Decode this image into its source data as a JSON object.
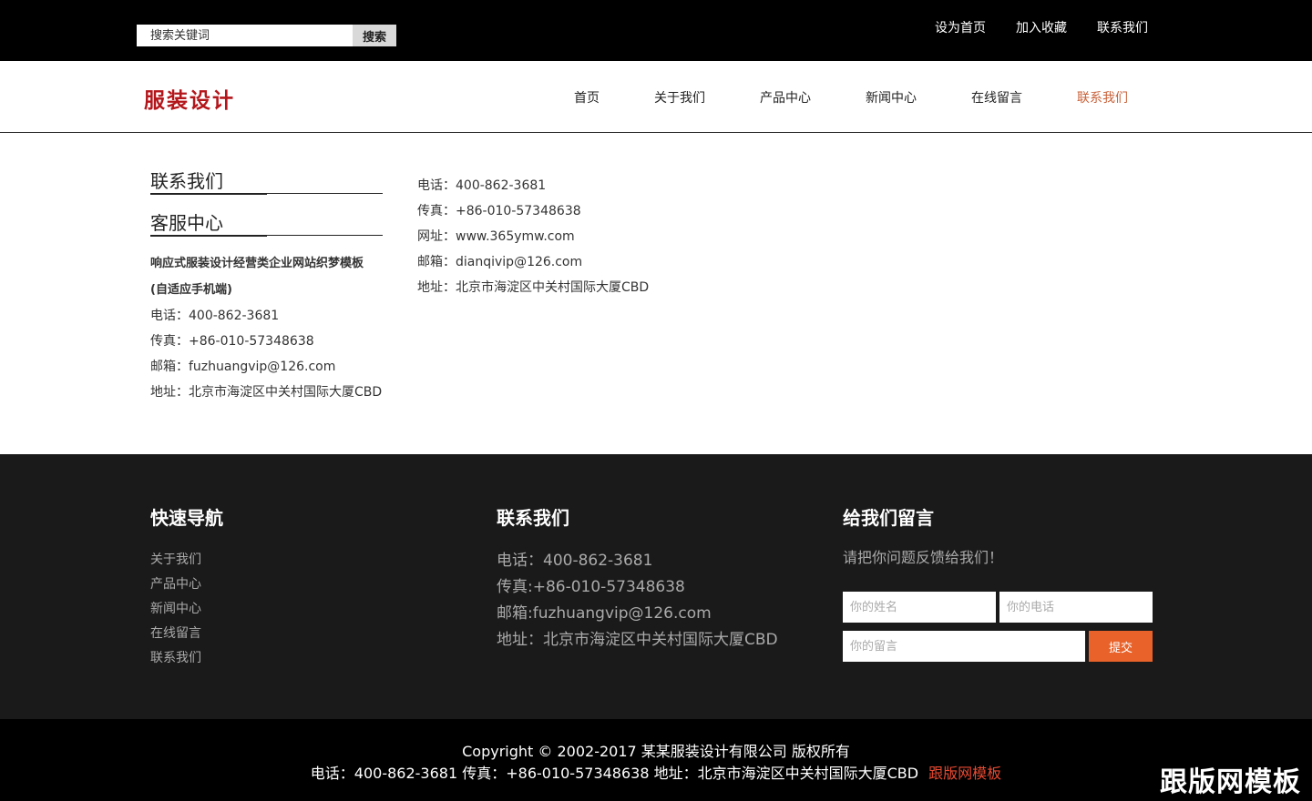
{
  "topbar": {
    "search_placeholder": "搜索关键词",
    "search_button": "搜索",
    "links": [
      "设为首页",
      "加入收藏",
      "联系我们"
    ]
  },
  "header": {
    "logo": "服装设计",
    "nav": [
      "首页",
      "关于我们",
      "产品中心",
      "新闻中心",
      "在线留言",
      "联系我们"
    ],
    "active_color": "#c8623a"
  },
  "sidebar": {
    "title_contact": "联系我们",
    "title_service": "客服中心",
    "company_line1": "响应式服装设计经营类企业网站织梦模板",
    "company_line2": "(自适应手机端)",
    "phone": "电话：400-862-3681",
    "fax": "传真：+86-010-57348638",
    "email": "邮箱：fuzhuangvip@126.com",
    "address": "地址：北京市海淀区中关村国际大厦CBD"
  },
  "main": {
    "phone": "电话：400-862-3681",
    "fax": "传真：+86-010-57348638",
    "website": "网址：www.365ymw.com",
    "email": "邮箱：dianqivip@126.com",
    "address": "地址：北京市海淀区中关村国际大厦CBD"
  },
  "footer": {
    "quicknav_title": "快速导航",
    "quicknav": [
      "关于我们",
      "产品中心",
      "新闻中心",
      "在线留言",
      "联系我们"
    ],
    "contact_title": "联系我们",
    "contact_phone": "电话：400-862-3681",
    "contact_fax": "传真:+86-010-57348638",
    "contact_email": "邮箱:fuzhuangvip@126.com",
    "contact_address": "地址：北京市海淀区中关村国际大厦CBD",
    "message_title": "给我们留言",
    "message_tip": "请把你问题反馈给我们！",
    "name_placeholder": "你的姓名",
    "phone_placeholder": "你的电话",
    "message_placeholder": "你的留言",
    "submit": "提交",
    "accent": "#e8622a"
  },
  "bottom": {
    "copyright": "Copyright © 2002-2017 某某服装设计有限公司 版权所有",
    "contact_line": "电话：400-862-3681 传真：+86-010-57348638 地址：北京市海淀区中关村国际大厦CBD",
    "brand_link": "跟版网模板",
    "watermark": "跟版网模板"
  }
}
